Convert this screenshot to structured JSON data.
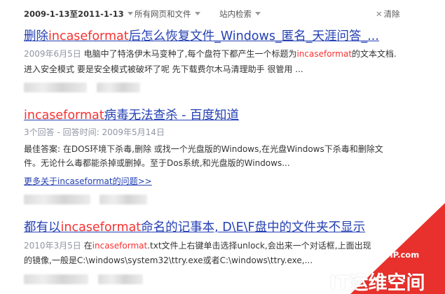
{
  "filter_bar": {
    "time_range": "2009-1-13至2011-1-13",
    "scope": "所有网页和文件",
    "site_search": "站内检索",
    "clear": "清除"
  },
  "results": [
    {
      "title_parts": [
        "删除",
        "incaseformat",
        "后怎么恢复文件_Windows_匿名_天涯问答_..."
      ],
      "date": "2009年6月5日",
      "line1_a": "电脑中了特洛伊木马变种了,每个盘符下都产生一个标题为",
      "line1_hl": "incaseformat",
      "line1_b": "的文本文档.",
      "line2": "进入安全模式 要是安全模式被破坏了呢 先下载费尔木马清理助手 很管用 ..."
    },
    {
      "title_hl": "incaseformat",
      "title_rest": "病毒无法查杀 - 百度知道",
      "meta": "3个回答 - 回答时间: 2009年5月14日",
      "line1": "最佳答案: 在DOS环境下杀毒,删除 或找一个光盘版的Windows,在光盘Windows下杀毒和删除文",
      "line2": "件。无论什么毒都能杀掉或删掉。至于Dos系统,和光盘版的Windows...",
      "more": "更多关于incaseformat的问题>>"
    },
    {
      "title_a": "都有以",
      "title_hl": "incaseformat",
      "title_b": "命名的记事本, D\\E\\F盘中的文件夹不显示",
      "date": "2010年3月5日",
      "line1_a": "在",
      "line1_hl": "incaseformat",
      "line1_b": ".txt文件上右键单击选择unlock,会出来一个对话框,上面出现",
      "line2": "的镜像,一般是C:\\windows\\system32\\ttry.exe或者C:\\windows\\ttry.exe,..."
    }
  ],
  "watermark": {
    "site": "www.94IP.com",
    "brand": "IT运维空间",
    "color": "#e8312c"
  },
  "colors": {
    "link": "#2440b3",
    "highlight": "#f73131",
    "meta": "#9195a3"
  }
}
